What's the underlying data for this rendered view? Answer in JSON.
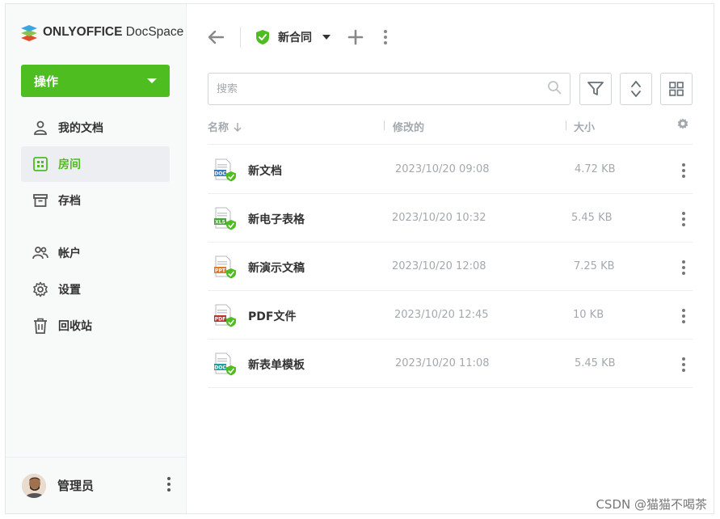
{
  "brand": {
    "name_bold": "ONLYOFFICE",
    "name_regular": " DocSpace"
  },
  "sidebar": {
    "actions_label": "操作",
    "items": [
      {
        "label": "我的文档",
        "icon": "person-icon"
      },
      {
        "label": "房间",
        "icon": "rooms-icon",
        "active": true
      },
      {
        "label": "存档",
        "icon": "archive-icon"
      },
      {
        "label": "帐户",
        "icon": "accounts-icon"
      },
      {
        "label": "设置",
        "icon": "gear-icon"
      },
      {
        "label": "回收站",
        "icon": "trash-icon"
      }
    ],
    "user": {
      "name": "管理员"
    }
  },
  "header": {
    "room_title": "新合同"
  },
  "search": {
    "placeholder": "搜索"
  },
  "table": {
    "columns": {
      "name": "名称",
      "modified": "修改的",
      "size": "大小"
    },
    "rows": [
      {
        "name": "新文档",
        "date": "2023/10/20  09:08",
        "size": "4.72 KB",
        "type": "DOC",
        "color": "#3a7cc4"
      },
      {
        "name": "新电子表格",
        "date": "2023/10/20  10:32",
        "size": "5.45 KB",
        "type": "XLS",
        "color": "#4aa03a"
      },
      {
        "name": "新演示文稿",
        "date": "2023/10/20  12:08",
        "size": "7.25 KB",
        "type": "PPT",
        "color": "#e07a2e"
      },
      {
        "name": "PDF文件",
        "date": "2023/10/20  12:45",
        "size": "10 KB",
        "type": "PDF",
        "color": "#b8312f"
      },
      {
        "name": "新表单模板",
        "date": "2023/10/20  11:08",
        "size": "5.45 KB",
        "type": "DOC",
        "color": "#1aa3a3"
      }
    ]
  },
  "colors": {
    "accent": "#4dbd1f",
    "muted": "#a3a9ae",
    "text": "#333333"
  },
  "watermark": "CSDN @猫猫不喝茶"
}
